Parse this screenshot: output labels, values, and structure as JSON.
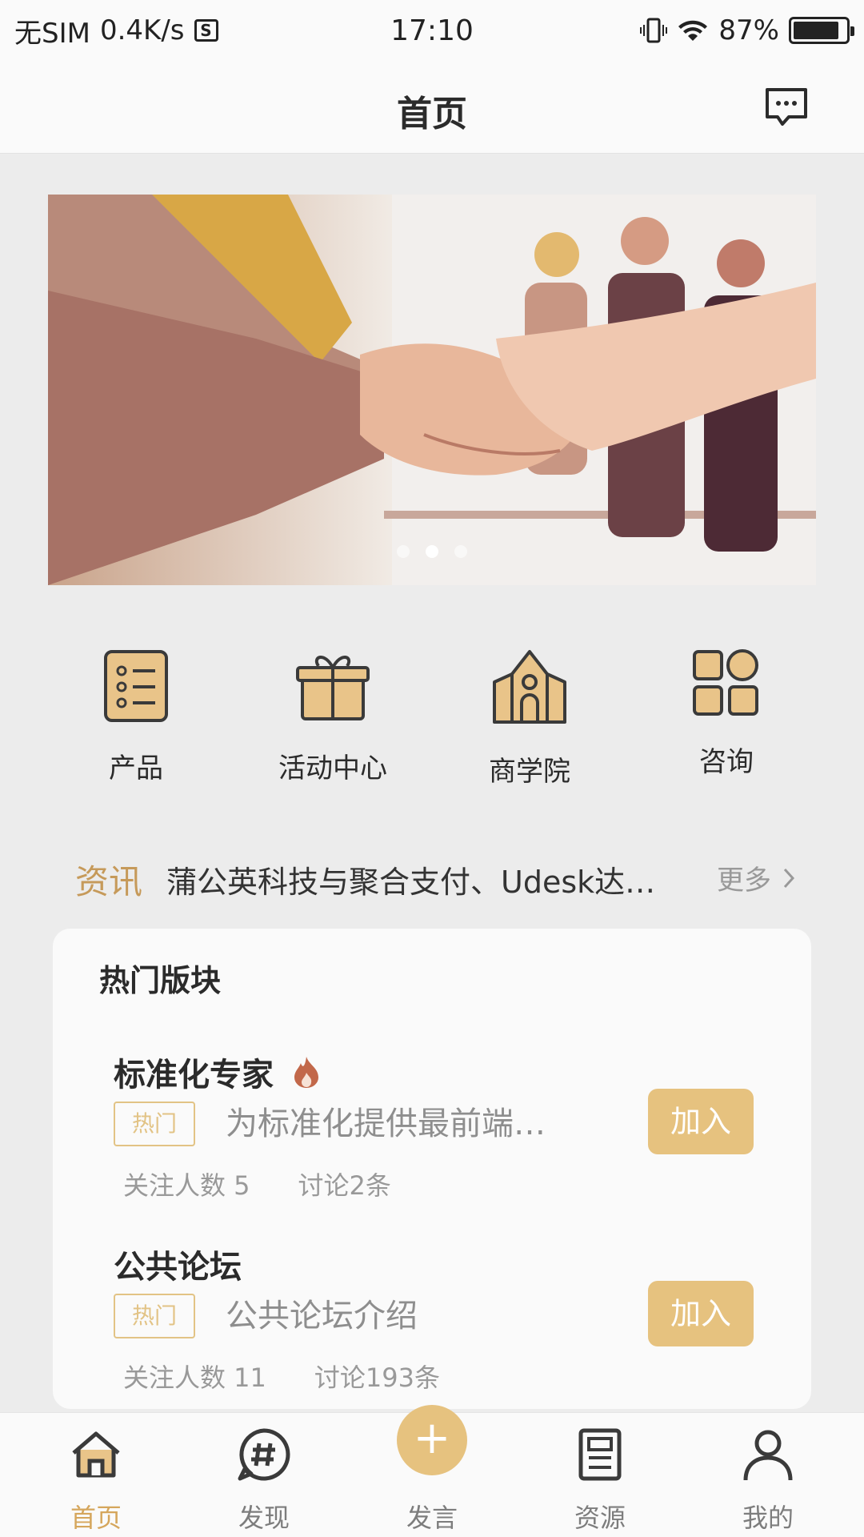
{
  "status_bar": {
    "carrier": "无SIM",
    "speed": "0.4K/s",
    "sim_icon": "S",
    "time": "17:10",
    "battery": "87%",
    "battery_level": 0.87
  },
  "header": {
    "title": "首页",
    "message_icon": "message-icon"
  },
  "banner": {
    "image": "handshake-photo",
    "slides": 3,
    "active_slide": 1
  },
  "quick_menu": [
    {
      "label": "产品",
      "icon": "list-icon"
    },
    {
      "label": "活动中心",
      "icon": "gift-icon"
    },
    {
      "label": "商学院",
      "icon": "school-icon"
    },
    {
      "label": "咨询",
      "icon": "grid-icon"
    }
  ],
  "news": {
    "tag": "资讯",
    "headline": "蒲公英科技与聚合支付、Udesk达…",
    "more": "更多"
  },
  "hot_section": {
    "title": "热门版块",
    "boards": [
      {
        "name": "标准化专家",
        "fire": true,
        "badge": "热门",
        "description": "为标准化提供最前端…",
        "followers": "关注人数 5",
        "discussions": "讨论2条",
        "join": "加入"
      },
      {
        "name": "公共论坛",
        "fire": false,
        "badge": "热门",
        "description": "公共论坛介绍",
        "followers": "关注人数 11",
        "discussions": "讨论193条",
        "join": "加入"
      }
    ]
  },
  "tab_bar": [
    {
      "label": "首页",
      "icon": "home-icon",
      "active": true
    },
    {
      "label": "发现",
      "icon": "hashtag-icon",
      "active": false
    },
    {
      "label": "发言",
      "icon": "plus-icon",
      "active": false
    },
    {
      "label": "资源",
      "icon": "document-icon",
      "active": false
    },
    {
      "label": "我的",
      "icon": "user-icon",
      "active": false
    }
  ],
  "colors": {
    "accent": "#e6c27f",
    "accent_text": "#d5a65c",
    "news_tag": "#c69a5a",
    "background": "#ececec"
  }
}
